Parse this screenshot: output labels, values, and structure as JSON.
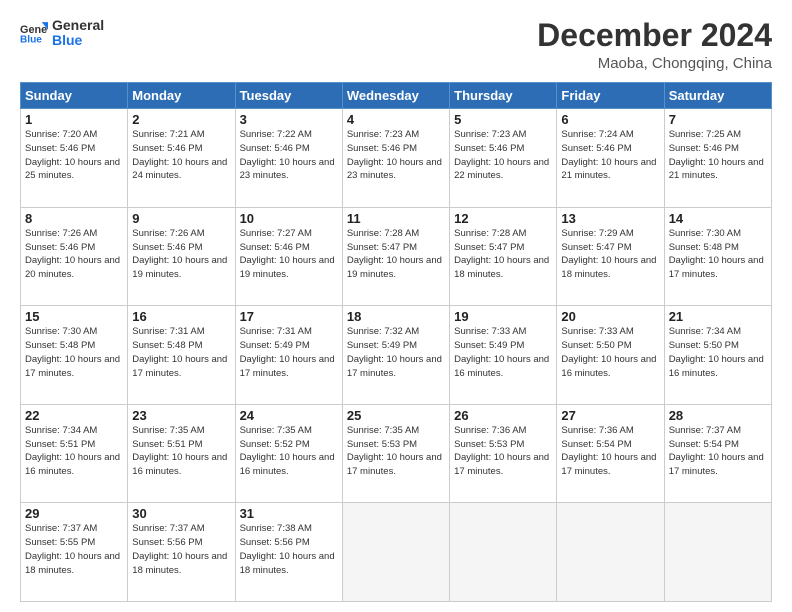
{
  "header": {
    "logo_line1": "General",
    "logo_line2": "Blue",
    "month": "December 2024",
    "location": "Maoba, Chongqing, China"
  },
  "weekdays": [
    "Sunday",
    "Monday",
    "Tuesday",
    "Wednesday",
    "Thursday",
    "Friday",
    "Saturday"
  ],
  "weeks": [
    [
      {
        "day": 1,
        "sunrise": "7:20 AM",
        "sunset": "5:46 PM",
        "daylight": "10 hours and 25 minutes."
      },
      {
        "day": 2,
        "sunrise": "7:21 AM",
        "sunset": "5:46 PM",
        "daylight": "10 hours and 24 minutes."
      },
      {
        "day": 3,
        "sunrise": "7:22 AM",
        "sunset": "5:46 PM",
        "daylight": "10 hours and 23 minutes."
      },
      {
        "day": 4,
        "sunrise": "7:23 AM",
        "sunset": "5:46 PM",
        "daylight": "10 hours and 23 minutes."
      },
      {
        "day": 5,
        "sunrise": "7:23 AM",
        "sunset": "5:46 PM",
        "daylight": "10 hours and 22 minutes."
      },
      {
        "day": 6,
        "sunrise": "7:24 AM",
        "sunset": "5:46 PM",
        "daylight": "10 hours and 21 minutes."
      },
      {
        "day": 7,
        "sunrise": "7:25 AM",
        "sunset": "5:46 PM",
        "daylight": "10 hours and 21 minutes."
      }
    ],
    [
      {
        "day": 8,
        "sunrise": "7:26 AM",
        "sunset": "5:46 PM",
        "daylight": "10 hours and 20 minutes."
      },
      {
        "day": 9,
        "sunrise": "7:26 AM",
        "sunset": "5:46 PM",
        "daylight": "10 hours and 19 minutes."
      },
      {
        "day": 10,
        "sunrise": "7:27 AM",
        "sunset": "5:46 PM",
        "daylight": "10 hours and 19 minutes."
      },
      {
        "day": 11,
        "sunrise": "7:28 AM",
        "sunset": "5:47 PM",
        "daylight": "10 hours and 19 minutes."
      },
      {
        "day": 12,
        "sunrise": "7:28 AM",
        "sunset": "5:47 PM",
        "daylight": "10 hours and 18 minutes."
      },
      {
        "day": 13,
        "sunrise": "7:29 AM",
        "sunset": "5:47 PM",
        "daylight": "10 hours and 18 minutes."
      },
      {
        "day": 14,
        "sunrise": "7:30 AM",
        "sunset": "5:48 PM",
        "daylight": "10 hours and 17 minutes."
      }
    ],
    [
      {
        "day": 15,
        "sunrise": "7:30 AM",
        "sunset": "5:48 PM",
        "daylight": "10 hours and 17 minutes."
      },
      {
        "day": 16,
        "sunrise": "7:31 AM",
        "sunset": "5:48 PM",
        "daylight": "10 hours and 17 minutes."
      },
      {
        "day": 17,
        "sunrise": "7:31 AM",
        "sunset": "5:49 PM",
        "daylight": "10 hours and 17 minutes."
      },
      {
        "day": 18,
        "sunrise": "7:32 AM",
        "sunset": "5:49 PM",
        "daylight": "10 hours and 17 minutes."
      },
      {
        "day": 19,
        "sunrise": "7:33 AM",
        "sunset": "5:49 PM",
        "daylight": "10 hours and 16 minutes."
      },
      {
        "day": 20,
        "sunrise": "7:33 AM",
        "sunset": "5:50 PM",
        "daylight": "10 hours and 16 minutes."
      },
      {
        "day": 21,
        "sunrise": "7:34 AM",
        "sunset": "5:50 PM",
        "daylight": "10 hours and 16 minutes."
      }
    ],
    [
      {
        "day": 22,
        "sunrise": "7:34 AM",
        "sunset": "5:51 PM",
        "daylight": "10 hours and 16 minutes."
      },
      {
        "day": 23,
        "sunrise": "7:35 AM",
        "sunset": "5:51 PM",
        "daylight": "10 hours and 16 minutes."
      },
      {
        "day": 24,
        "sunrise": "7:35 AM",
        "sunset": "5:52 PM",
        "daylight": "10 hours and 16 minutes."
      },
      {
        "day": 25,
        "sunrise": "7:35 AM",
        "sunset": "5:53 PM",
        "daylight": "10 hours and 17 minutes."
      },
      {
        "day": 26,
        "sunrise": "7:36 AM",
        "sunset": "5:53 PM",
        "daylight": "10 hours and 17 minutes."
      },
      {
        "day": 27,
        "sunrise": "7:36 AM",
        "sunset": "5:54 PM",
        "daylight": "10 hours and 17 minutes."
      },
      {
        "day": 28,
        "sunrise": "7:37 AM",
        "sunset": "5:54 PM",
        "daylight": "10 hours and 17 minutes."
      }
    ],
    [
      {
        "day": 29,
        "sunrise": "7:37 AM",
        "sunset": "5:55 PM",
        "daylight": "10 hours and 18 minutes."
      },
      {
        "day": 30,
        "sunrise": "7:37 AM",
        "sunset": "5:56 PM",
        "daylight": "10 hours and 18 minutes."
      },
      {
        "day": 31,
        "sunrise": "7:38 AM",
        "sunset": "5:56 PM",
        "daylight": "10 hours and 18 minutes."
      },
      null,
      null,
      null,
      null
    ]
  ]
}
